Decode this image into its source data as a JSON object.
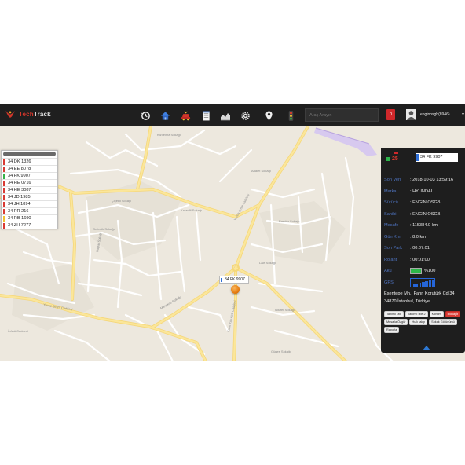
{
  "header": {
    "logo_part1": "Tech",
    "logo_part2": "Track",
    "search_placeholder": "Araç Arayın",
    "alert_count": "0",
    "username": "enginosgb(8946)",
    "toolbar_icons": [
      "history-icon",
      "home-icon",
      "car-icon",
      "document-icon",
      "chart-icon",
      "settings-icon",
      "location-pin-icon",
      "traffic-light-icon"
    ]
  },
  "plate_list": {
    "items": [
      {
        "plate": "34 DK 1326",
        "status_color": "#d93a33"
      },
      {
        "plate": "34 EE 8078",
        "status_color": "#d93a33"
      },
      {
        "plate": "34 FK 9907",
        "status_color": "#37b34a"
      },
      {
        "plate": "34 HE 0716",
        "status_color": "#d93a33"
      },
      {
        "plate": "34 HE 3087",
        "status_color": "#d93a33"
      },
      {
        "plate": "34 JD 1985",
        "status_color": "#d93a33"
      },
      {
        "plate": "34 JH 1894",
        "status_color": "#d93a33"
      },
      {
        "plate": "34 PR 216",
        "status_color": "#d93a33"
      },
      {
        "plate": "34 RB 1690",
        "status_color": "#f2c230"
      },
      {
        "plate": "34 ZH 7277",
        "status_color": "#d93a33"
      }
    ]
  },
  "map": {
    "vehicle_label": "34 FK 9907",
    "streets": {
      "s1": "Kızılelma Sokağı",
      "s2": "Adalet Sokağı",
      "s3": "Çiçekli Sokağı",
      "s4": "Karanfil Sokağı",
      "s5": "Yunus Emre Caddesi",
      "s6": "Fahri Korutürk Caddesi",
      "s7": "Lale Sokağı",
      "s8": "Gelincik Sokağı",
      "s9": "Erenler Sokağı",
      "s10": "Yavuz Selim Caddesi",
      "s11": "Menekşe Sokağı",
      "s12": "İnönü Caddesi",
      "s13": "Bağlar Sokağı",
      "s14": "Nilüfer Sokağı",
      "s15": "Güneş Sokağı",
      "s16": "Atatürk Caddesi"
    }
  },
  "panel": {
    "speed": "25",
    "plate": "34 FK 9907",
    "rows": [
      {
        "key": "Son Veri",
        "value": ": 2018-10-03 13:59:16"
      },
      {
        "key": "Marka",
        "value": ": HYUNDAI"
      },
      {
        "key": "Sürücü",
        "value": ": ENGIN OSGB"
      },
      {
        "key": "Sahibi",
        "value": ": ENGIN OSGB"
      },
      {
        "key": "Mesafe",
        "value": ": 115384.0 km"
      },
      {
        "key": "Gün Km",
        "value": ": 8.0 km"
      },
      {
        "key": "Son Park",
        "value": ": 00:07:01"
      },
      {
        "key": "Rolanti",
        "value": ": 00:01:00"
      }
    ],
    "battery_label": "Akü",
    "battery_value": "%100",
    "battery_level": 1.0,
    "gps_label": "GPS",
    "gps_bars": 12,
    "address_line1": "Esentepe Mh., Fahri Korutürk Cd 34",
    "address_line2": "34870 İstanbul, Türkiye",
    "buttons": [
      {
        "label": "Tanımlı İzle",
        "danger": false
      },
      {
        "label": "Tanımlı İzle 2",
        "danger": false
      },
      {
        "label": "Konum",
        "danger": false
      },
      {
        "label": "Blokaj İt",
        "danger": true
      },
      {
        "label": "Mesajla Özgür",
        "danger": false
      },
      {
        "label": "Hızlı takip",
        "danger": false
      },
      {
        "label": "Sokak Görünümü",
        "danger": false
      },
      {
        "label": "Raporla",
        "danger": false
      }
    ]
  },
  "colors": {
    "topbar": "#1f1f1f",
    "panel": "#1e1e1e",
    "panel_key": "#4f74c2",
    "accent_blue": "#2f6fd6",
    "marker_orange": "#e77d11",
    "road_yellow": "#fbe69a"
  }
}
